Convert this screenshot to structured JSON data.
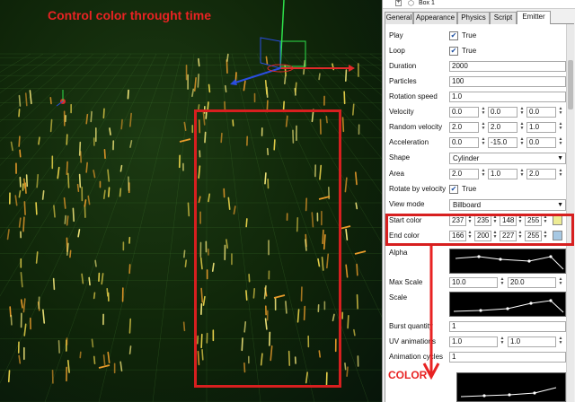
{
  "annotation": {
    "title": "Control color throught time",
    "color_label": "COLOR"
  },
  "tree": {
    "expand": "+",
    "item": "Box 1"
  },
  "tabs": [
    {
      "label": "General"
    },
    {
      "label": "Appearance"
    },
    {
      "label": "Physics"
    },
    {
      "label": "Script"
    },
    {
      "label": "Emitter",
      "active": true
    }
  ],
  "props": {
    "play": {
      "label": "Play",
      "checked": true,
      "text": "True"
    },
    "loop": {
      "label": "Loop",
      "checked": true,
      "text": "True"
    },
    "duration": {
      "label": "Duration",
      "value": "2000"
    },
    "particles": {
      "label": "Particles",
      "value": "100"
    },
    "rotation_speed": {
      "label": "Rotation speed",
      "value": "1.0"
    },
    "velocity": {
      "label": "Velocity",
      "values": [
        "0.0",
        "0.0",
        "0.0"
      ]
    },
    "random_velocity": {
      "label": "Random velocity",
      "values": [
        "2.0",
        "2.0",
        "1.0"
      ]
    },
    "acceleration": {
      "label": "Acceleration",
      "values": [
        "0.0",
        "-15.0",
        "0.0"
      ]
    },
    "shape": {
      "label": "Shape",
      "value": "Cylinder"
    },
    "area": {
      "label": "Area",
      "values": [
        "2.0",
        "1.0",
        "2.0"
      ]
    },
    "rotate_by_velocity": {
      "label": "Rotate by velocity",
      "checked": true,
      "text": "True"
    },
    "view_mode": {
      "label": "View mode",
      "value": "Billboard"
    },
    "start_color": {
      "label": "Start color",
      "values": [
        "237",
        "235",
        "148",
        "255"
      ],
      "swatch": "#edeb94"
    },
    "end_color": {
      "label": "End color",
      "values": [
        "166",
        "200",
        "227",
        "255"
      ],
      "swatch": "#a6c8e3"
    },
    "alpha": {
      "label": "Alpha"
    },
    "max_scale": {
      "label": "Max Scale",
      "values": [
        "10.0",
        "20.0"
      ]
    },
    "scale": {
      "label": "Scale"
    },
    "burst_quantity": {
      "label": "Burst quantity",
      "value": "1"
    },
    "uv_animations": {
      "label": "UV animations",
      "values": [
        "1.0",
        "1.0"
      ]
    },
    "animation_cycles": {
      "label": "Animation cycles",
      "value": "1"
    }
  },
  "colors": {
    "annotation_red": "#e82323",
    "particle_yellow": "#e8d24a",
    "particle_orange": "#e89b2a"
  }
}
